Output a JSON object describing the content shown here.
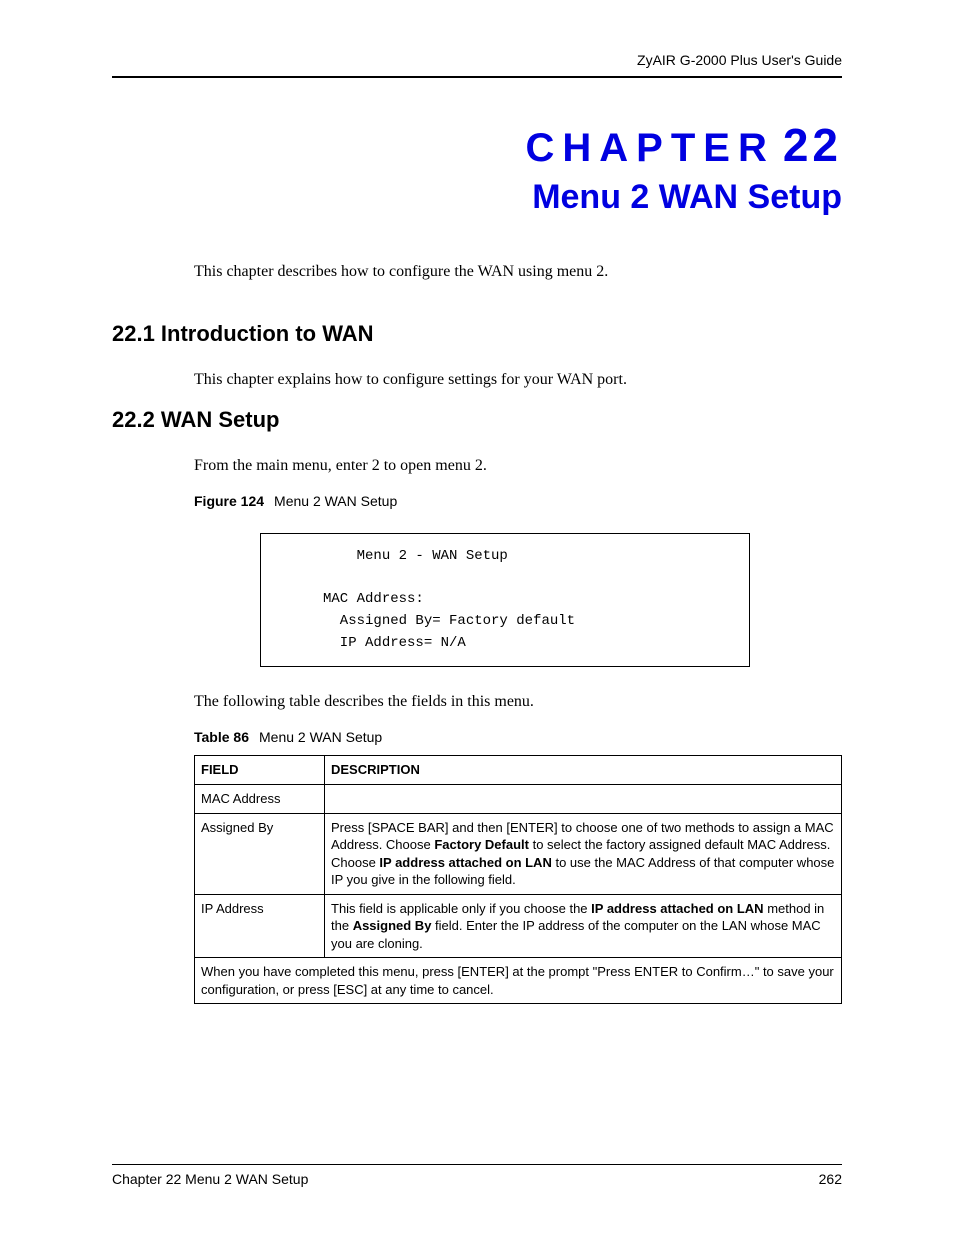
{
  "header": {
    "guide_title": "ZyAIR G-2000 Plus User's Guide"
  },
  "chapter": {
    "label_word": "CHAPTER",
    "label_num": "22",
    "title": "Menu 2 WAN Setup",
    "intro": "This chapter describes how to configure the WAN using menu 2."
  },
  "section1": {
    "heading": "22.1  Introduction to WAN",
    "body": "This chapter explains how to configure settings for your WAN port."
  },
  "section2": {
    "heading": "22.2  WAN Setup",
    "body": "From the main menu, enter 2 to open menu 2.",
    "figure_label": "Figure 124",
    "figure_title": "Menu 2 WAN Setup",
    "terminal": {
      "line1": "         Menu 2 - WAN Setup",
      "line2": "",
      "line3": "     MAC Address:",
      "line4": "       Assigned By= Factory default",
      "line5": "       IP Address= N/A"
    },
    "after_figure": "The following table describes the fields in this menu.",
    "table_label": "Table 86",
    "table_title": "Menu 2 WAN Setup",
    "table": {
      "h1": "FIELD",
      "h2": "DESCRIPTION",
      "rows": [
        {
          "field": "MAC Address",
          "desc_pre": "",
          "bold1": "",
          "mid1": "",
          "bold2": "",
          "tail": ""
        },
        {
          "field": "Assigned By",
          "desc_pre": "Press [SPACE BAR] and then [ENTER] to choose one of two methods to assign a MAC Address. Choose ",
          "bold1": "Factory Default",
          "mid1": " to select the factory assigned default MAC Address. Choose ",
          "bold2": "IP address attached on LAN",
          "tail": " to use the MAC Address of that computer whose IP you give in the following field."
        },
        {
          "field": "IP Address",
          "desc_pre": "This field is applicable only if you choose the ",
          "bold1": "IP address attached on LAN",
          "mid1": " method in the ",
          "bold2": "Assigned By",
          "tail": " field. Enter the IP address of the computer on the LAN whose MAC you are cloning."
        }
      ],
      "footer_row": "When you have completed this menu, press [ENTER] at the prompt \"Press ENTER to Confirm…\" to save your configuration, or press [ESC] at any time to cancel."
    }
  },
  "footer": {
    "left": "Chapter 22 Menu 2 WAN Setup",
    "right": "262"
  }
}
